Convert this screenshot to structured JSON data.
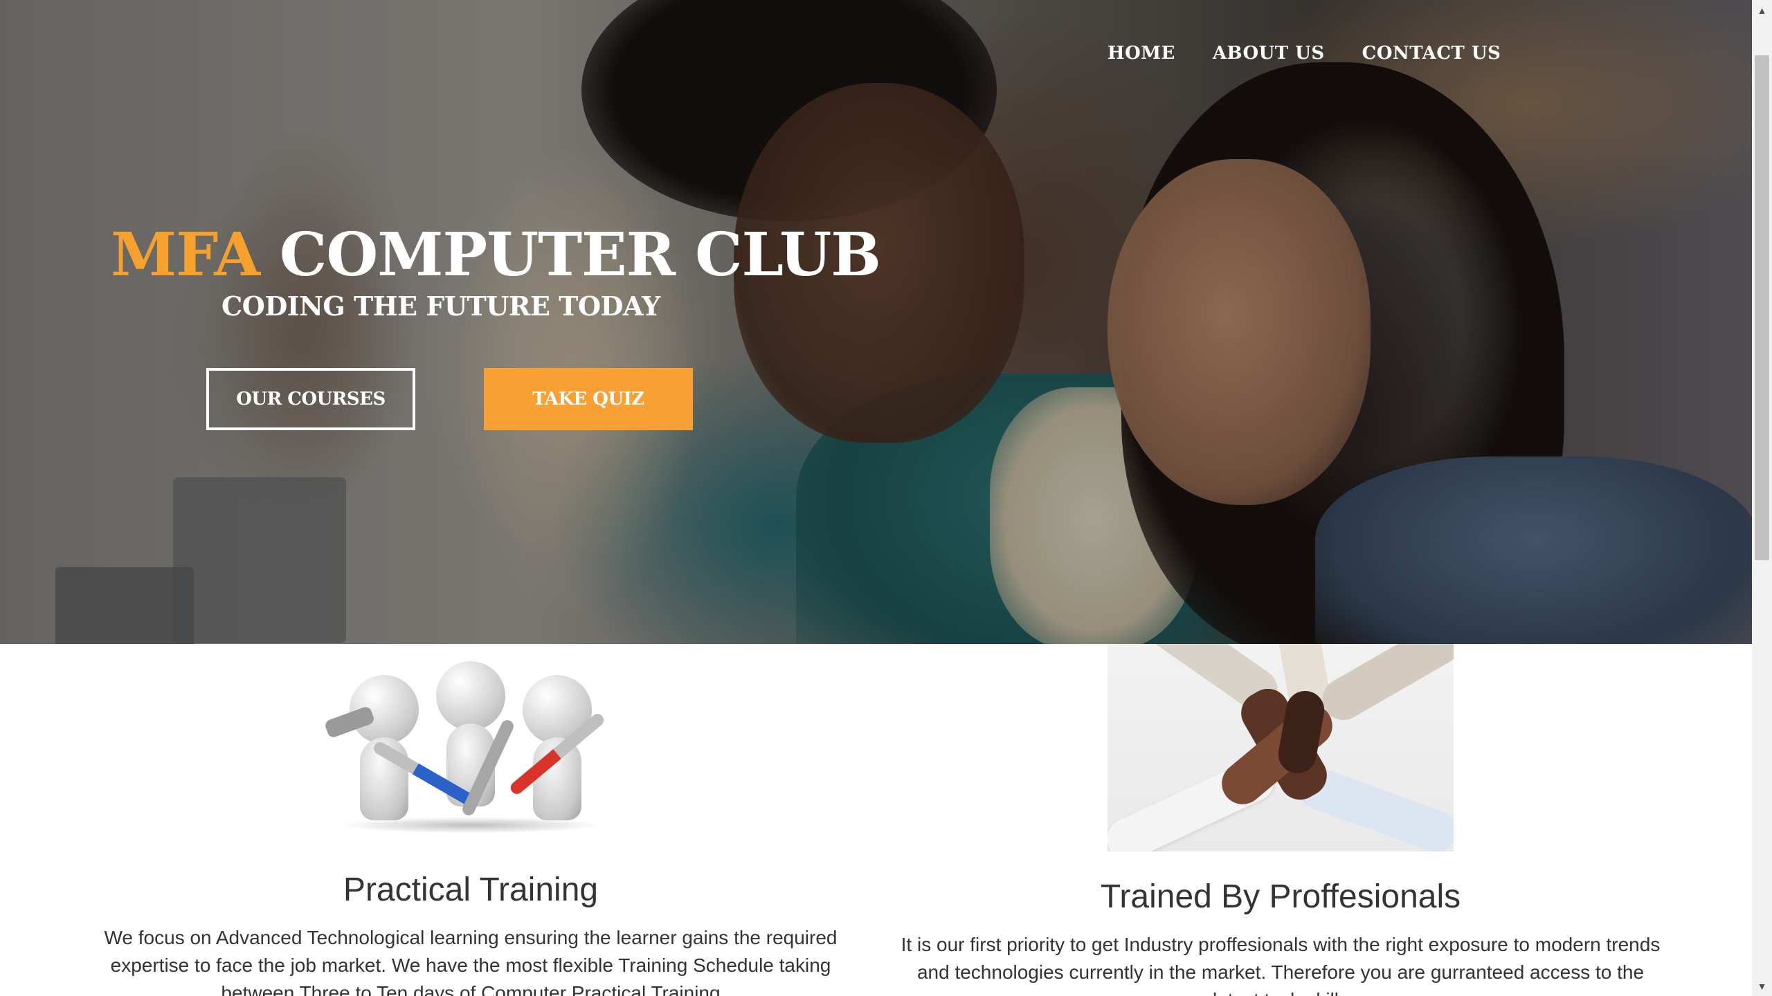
{
  "nav": {
    "items": [
      "HOME",
      "ABOUT US",
      "CONTACT US"
    ]
  },
  "hero": {
    "title_accent": "MFA",
    "title_rest": "COMPUTER CLUB",
    "subtitle": "CODING THE FUTURE TODAY",
    "btn_courses": "OUR COURSES",
    "btn_quiz": "TAKE QUIZ"
  },
  "features": [
    {
      "title": "Practical Training",
      "text": "We focus on Advanced Technological learning ensuring the learner gains the required expertise to face the job market. We have the most flexible Training Schedule taking between Three to Ten days of Computer Practical Training",
      "image_icon": "team-tools-figures-image"
    },
    {
      "title": "Trained By Proffesionals",
      "text": "It is our first priority to get Industry proffesionals with the right exposure to modern trends and technologies currently in the market. Therefore you are gurranteed access to the latest tech skills",
      "image_icon": "joined-hands-image"
    }
  ],
  "colors": {
    "accent": "#f8a033",
    "text_dark": "#333333",
    "white": "#ffffff"
  }
}
